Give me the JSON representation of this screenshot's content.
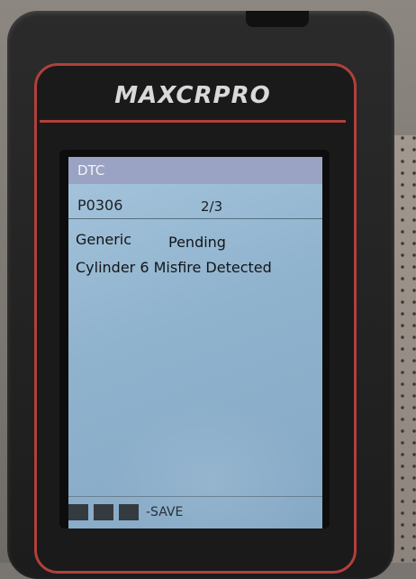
{
  "device": {
    "brand_logo": "MAXCRPRO"
  },
  "screen": {
    "title": "DTC",
    "dtc": {
      "code": "P0306",
      "counter": "2/3",
      "type": "Generic",
      "status": "Pending",
      "description": "Cylinder 6 Misfire Detected"
    },
    "bottom_bar": {
      "save_label": "-SAVE"
    }
  }
}
